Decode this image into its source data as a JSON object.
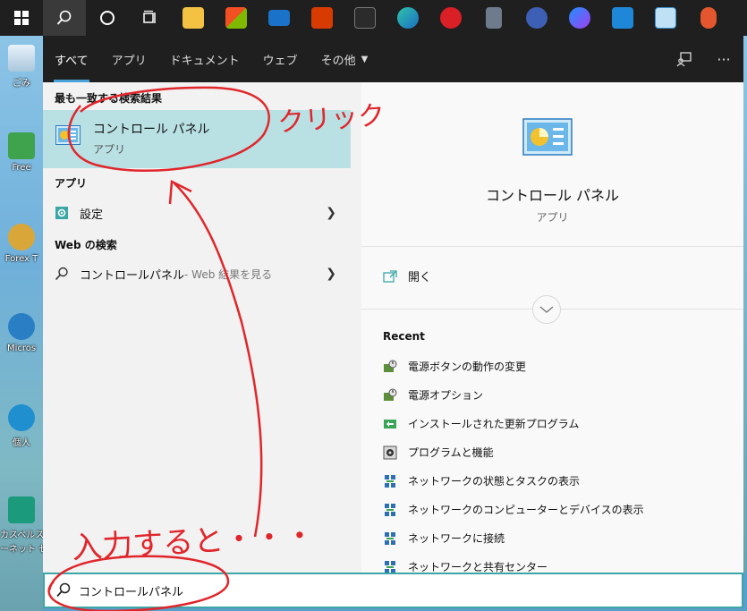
{
  "desktop": {
    "icons": [
      {
        "label": "ごみ"
      },
      {
        "label": "Free"
      },
      {
        "label": "Forex T"
      },
      {
        "label": "Micros"
      },
      {
        "label": "個人"
      },
      {
        "label": "カスペルス"
      },
      {
        "label": "ーネット セ"
      }
    ]
  },
  "taskbar": {
    "items": [
      "windows-start",
      "search",
      "cortana",
      "task-view",
      "file-explorer",
      "microsoft-store",
      "mail",
      "office",
      "terminal",
      "edge",
      "creative-cloud",
      "calculator",
      "paint",
      "messenger",
      "vscode",
      "control-panel-app",
      "app"
    ]
  },
  "header": {
    "tabs": [
      {
        "label": "すべて"
      },
      {
        "label": "アプリ"
      },
      {
        "label": "ドキュメント"
      },
      {
        "label": "ウェブ"
      },
      {
        "label": "その他"
      }
    ],
    "feedback_icon": "feedback-icon",
    "more_label": "···"
  },
  "results": {
    "best_match_title": "最も一致する検索結果",
    "best_match": {
      "name": "コントロール パネル",
      "type": "アプリ"
    },
    "apps_title": "アプリ",
    "apps": [
      {
        "label": "設定"
      }
    ],
    "web_title": "Web の検索",
    "web": [
      {
        "label": "コントロールパネル",
        "sub": " - Web 結果を見る"
      }
    ]
  },
  "preview": {
    "name": "コントロール パネル",
    "type": "アプリ",
    "open_label": "開く",
    "recent_title": "Recent",
    "recent": [
      {
        "label": "電源ボタンの動作の変更",
        "icon": "power-options-icon"
      },
      {
        "label": "電源オプション",
        "icon": "power-options-icon"
      },
      {
        "label": "インストールされた更新プログラム",
        "icon": "updates-icon"
      },
      {
        "label": "プログラムと機能",
        "icon": "programs-icon"
      },
      {
        "label": "ネットワークの状態とタスクの表示",
        "icon": "network-icon"
      },
      {
        "label": "ネットワークのコンピューターとデバイスの表示",
        "icon": "network-icon"
      },
      {
        "label": "ネットワークに接続",
        "icon": "network-icon"
      },
      {
        "label": "ネットワークと共有センター",
        "icon": "network-icon"
      }
    ]
  },
  "search": {
    "value": "コントロールパネル"
  },
  "annotations": {
    "click_label": "クリック",
    "typing_label": "入力すると・・・"
  },
  "colors": {
    "accent": "#3aa7a6",
    "annotation": "#e0262b",
    "selection": "#b9e1e4"
  }
}
